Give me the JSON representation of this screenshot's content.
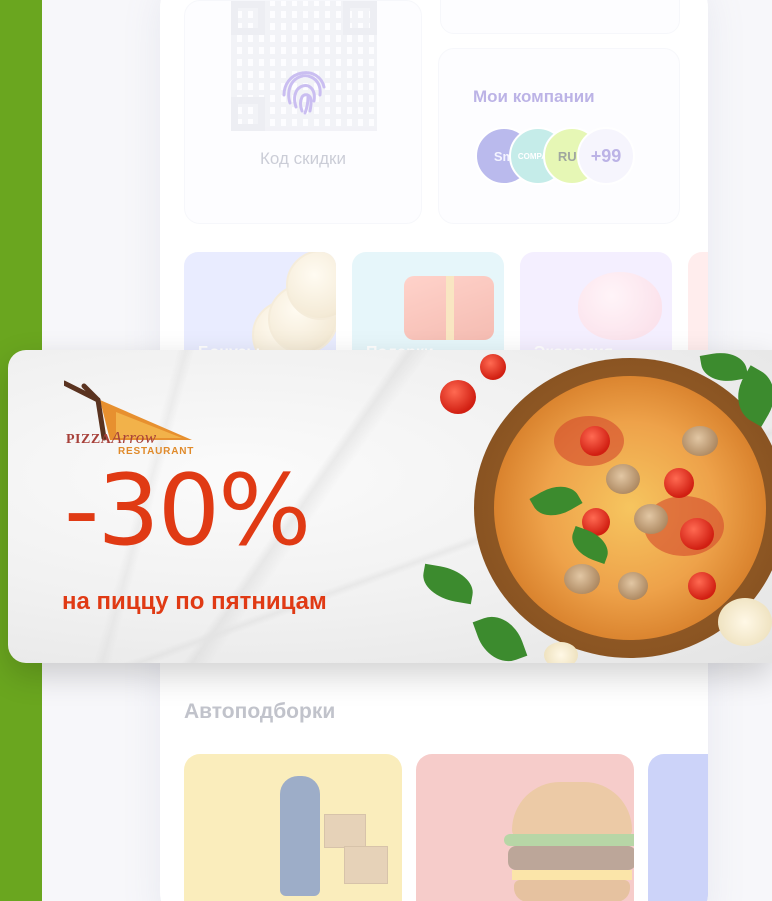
{
  "background": {
    "accent_green": "#6aa61f"
  },
  "app": {
    "discount_card": {
      "label": "Код скидки",
      "icon": "fingerprint-icon"
    },
    "companies_card": {
      "title": "Мои компании",
      "logos": [
        "Sm",
        "COMPANY",
        "RUH"
      ],
      "more": "+99"
    },
    "tiles": [
      {
        "label": "Бонусы"
      },
      {
        "label": "Подарки"
      },
      {
        "label": "Экономия"
      }
    ],
    "auto_section": {
      "title": "Автоподборки"
    }
  },
  "promo": {
    "brand": {
      "name": "PIZZA",
      "name_script": "Arrow",
      "sub": "RESTAURANT"
    },
    "discount": "-30%",
    "text": "на пиццу по пятницам",
    "colors": {
      "brand_red": "#e03a14",
      "brand_orange": "#e08a2a"
    }
  }
}
